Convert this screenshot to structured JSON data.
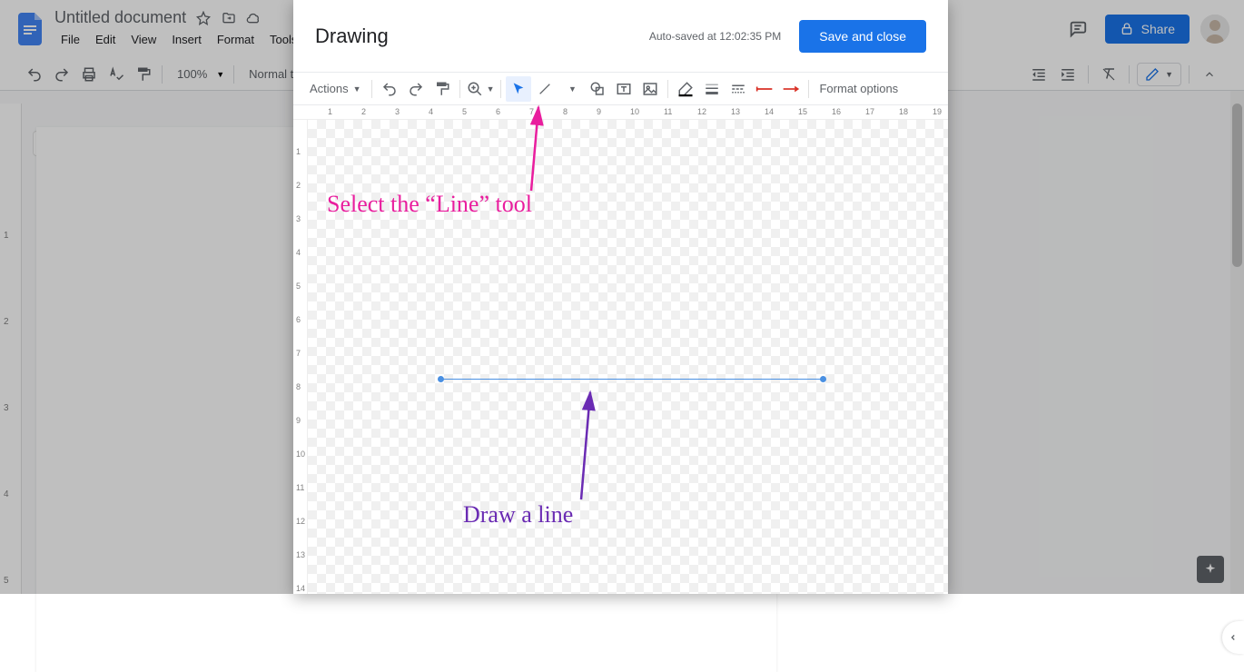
{
  "doc": {
    "title": "Untitled document",
    "menus": [
      "File",
      "Edit",
      "View",
      "Insert",
      "Format",
      "Tools"
    ],
    "share": "Share"
  },
  "toolbar": {
    "zoom": "100%",
    "style": "Normal text"
  },
  "dialog": {
    "title": "Drawing",
    "autosave": "Auto-saved at 12:02:35 PM",
    "save": "Save and close",
    "actions": "Actions",
    "format_options": "Format options",
    "hruler": [
      "1",
      "2",
      "3",
      "4",
      "5",
      "6",
      "7",
      "8",
      "9",
      "10",
      "11",
      "12",
      "13",
      "14",
      "15",
      "16",
      "17",
      "18",
      "19"
    ],
    "vruler": [
      "1",
      "2",
      "3",
      "4",
      "5",
      "6",
      "7",
      "8",
      "9",
      "10",
      "11",
      "12",
      "13",
      "14"
    ]
  },
  "docs_vruler": [
    "1",
    "2",
    "3",
    "4",
    "5"
  ],
  "annotations": {
    "line_tool": "Select the “Line” tool",
    "draw_line": "Draw a line"
  }
}
